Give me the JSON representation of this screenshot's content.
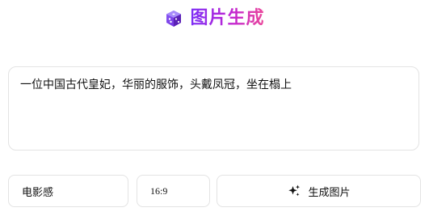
{
  "header": {
    "logo_icon": "dice-icon",
    "title": "图片生成",
    "title_gradient": [
      "#7b2ff7",
      "#c026d3",
      "#ec4899"
    ]
  },
  "prompt": {
    "value": "一位中国古代皇妃，华丽的服饰，头戴凤冠，坐在榻上"
  },
  "controls": {
    "style_value": "电影感",
    "ratio_value": "16:9",
    "generate_icon": "sparkles-icon",
    "generate_label": "生成图片"
  }
}
